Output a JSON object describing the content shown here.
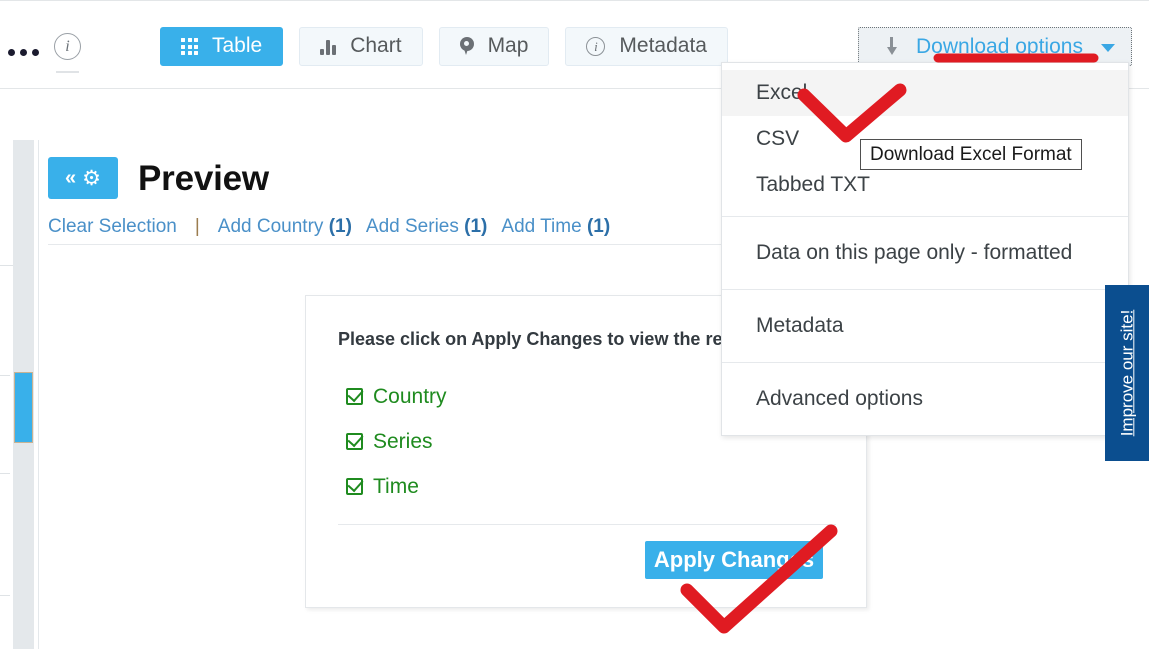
{
  "toolbar": {
    "overflow_icon": "ellipsis-icon",
    "info_icon": "info-circle-icon",
    "tabs": [
      {
        "label": "Table",
        "icon": "grid-icon",
        "active": true
      },
      {
        "label": "Chart",
        "icon": "bar-chart-icon",
        "active": false
      },
      {
        "label": "Map",
        "icon": "map-pin-icon",
        "active": false
      },
      {
        "label": "Metadata",
        "icon": "info-icon",
        "active": false
      }
    ],
    "download_button": {
      "label": "Download options",
      "icon": "download-arrow-icon",
      "caret": "chevron-down-icon",
      "focused": true,
      "annotated": true
    }
  },
  "dropdown": {
    "groups": [
      {
        "name": "formats",
        "items": [
          {
            "label": "Excel",
            "hovered": true
          },
          {
            "label": "CSV",
            "hovered": false
          },
          {
            "label": "Tabbed TXT",
            "hovered": false
          }
        ]
      },
      {
        "name": "page-data",
        "items": [
          {
            "label": "Data on this page only - formatted",
            "hovered": false
          }
        ]
      },
      {
        "name": "metadata",
        "items": [
          {
            "label": "Metadata",
            "hovered": false
          }
        ]
      },
      {
        "name": "advanced",
        "items": [
          {
            "label": "Advanced options",
            "hovered": false
          }
        ]
      }
    ]
  },
  "tooltip": {
    "text": "Download Excel Format"
  },
  "preview": {
    "collapse_chevron": "«",
    "gear_icon": "gear-icon",
    "title": "Preview",
    "links": {
      "clear_selection": "Clear Selection",
      "separator": "|",
      "add_country_label": "Add Country",
      "add_country_count": "(1)",
      "add_series_label": "Add Series",
      "add_series_count": "(1)",
      "add_time_label": "Add Time",
      "add_time_count": "(1)"
    }
  },
  "dialog": {
    "message": "Please click on Apply Changes to view the report",
    "items": [
      {
        "label": "Country",
        "checked": true
      },
      {
        "label": "Series",
        "checked": true
      },
      {
        "label": "Time",
        "checked": true
      }
    ],
    "apply_button": "Apply Changes"
  },
  "side_tab": {
    "label": "Improve our site!"
  },
  "colors": {
    "accent_blue": "#39b0ea",
    "link_blue": "#4a90c8",
    "check_green": "#1f8b1f",
    "annotation_red": "#e01b22",
    "side_tab_blue": "#0b4e8f"
  }
}
